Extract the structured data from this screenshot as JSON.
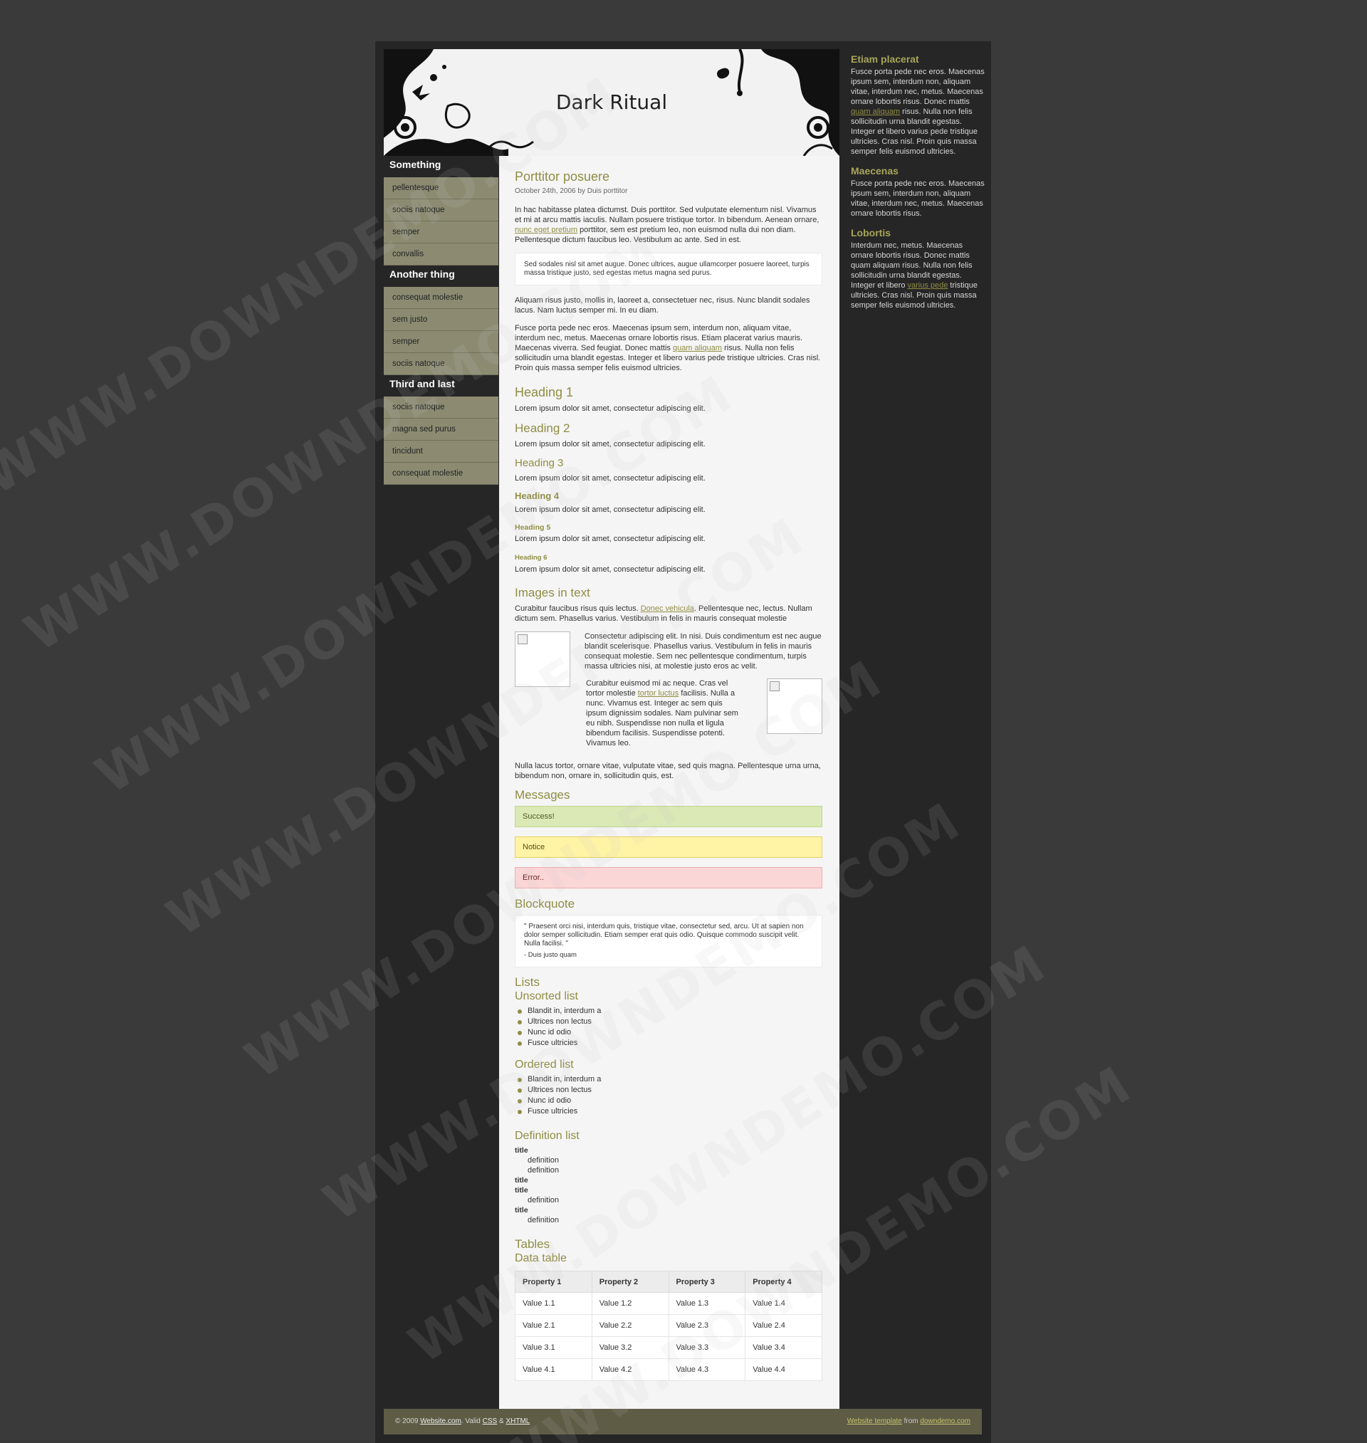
{
  "site_title": "Dark Ritual",
  "leftnav": [
    {
      "heading": "Something",
      "items": [
        "pellentesque",
        "sociis natoque",
        "semper",
        "convallis"
      ]
    },
    {
      "heading": "Another thing",
      "items": [
        "consequat molestie",
        "sem justo",
        "semper",
        "sociis natoque"
      ]
    },
    {
      "heading": "Third and last",
      "items": [
        "sociis natoque",
        "magna sed purus",
        "tincidunt",
        "consequat molestie"
      ]
    }
  ],
  "post": {
    "title": "Porttitor posuere",
    "meta": "October 24th, 2006 by Duis porttitor",
    "p1_a": "In hac habitasse platea dictumst. Duis porttitor. Sed vulputate elementum nisl. Vivamus et mi at arcu mattis iaculis. Nullam posuere tristique tortor. In bibendum. Aenean ornare, ",
    "p1_link": "nunc eget pretium",
    "p1_b": " porttitor, sem est pretium leo, non euismod nulla dui non diam. Pellentesque dictum faucibus leo. Vestibulum ac ante. Sed in est.",
    "quote": "Sed sodales nisl sit amet augue. Donec ultrices, augue ullamcorper posuere laoreet, turpis massa tristique justo, sed egestas metus magna sed purus.",
    "p2": "Aliquam risus justo, mollis in, laoreet a, consectetuer nec, risus. Nunc blandit sodales lacus. Nam luctus semper mi. In eu diam.",
    "p3_a": "Fusce porta pede nec eros. Maecenas ipsum sem, interdum non, aliquam vitae, interdum nec, metus. Maecenas ornare lobortis risus. Etiam placerat varius mauris. Maecenas viverra. Sed feugiat. Donec mattis ",
    "p3_link": "quam aliquam",
    "p3_b": " risus. Nulla non felis sollicitudin urna blandit egestas. Integer et libero varius pede tristique ultricies. Cras nisl. Proin quis massa semper felis euismod ultricies."
  },
  "headings": {
    "h1": "Heading 1",
    "h2": "Heading 2",
    "h3": "Heading 3",
    "h4": "Heading 4",
    "h5": "Heading 5",
    "h6": "Heading 6",
    "lorem": "Lorem ipsum dolor sit amet, consectetur adipiscing elit."
  },
  "images": {
    "title": "Images in text",
    "p1_a": "Curabitur faucibus risus quis lectus. ",
    "p1_link": "Donec vehicula",
    "p1_b": ". Pellentesque nec, lectus. Nullam dictum sem. Phasellus varius. Vestibulum in felis in mauris consequat molestie",
    "p2": "Consectetur adipiscing elit. In nisi. Duis condimentum est nec augue blandit scelerisque. Phasellus varius. Vestibulum in felis in mauris consequat molestie. Sem nec pellentesque condimentum, turpis massa ultricies nisi, at molestie justo eros ac velit.",
    "p3_a": "Curabitur euismod mi ac neque. Cras vel tortor molestie ",
    "p3_link": "tortor luctus",
    "p3_b": " facilisis. Nulla a nunc. Vivamus est. Integer ac sem quis ipsum dignissim sodales. Nam pulvinar sem eu nibh. Suspendisse non nulla et ligula bibendum facilisis. Suspendisse potenti. Vivamus leo.",
    "p4": "Nulla lacus tortor, ornare vitae, vulputate vitae, sed quis magna. Pellentesque urna urna, bibendum non, ornare in, sollicitudin quis, est."
  },
  "messages": {
    "title": "Messages",
    "success": "Success!",
    "notice": "Notice",
    "error": "Error.."
  },
  "blockquote": {
    "title": "Blockquote",
    "text": "\" Praesent orci nisi, interdum quis, tristique vitae, consectetur sed, arcu. Ut at sapien non dolor semper sollicitudin. Etiam semper erat quis odio. Quisque commodo suscipit velit. Nulla facilisi. \"",
    "cite": "- Duis justo quam"
  },
  "lists": {
    "title": "Lists",
    "unsorted_title": "Unsorted list",
    "unsorted": [
      "Blandit in, interdum a",
      "Ultrices non lectus",
      "Nunc id odio",
      "Fusce ultricies"
    ],
    "ordered_title": "Ordered list",
    "ordered": [
      "Blandit in, interdum a",
      "Ultrices non lectus",
      "Nunc id odio",
      "Fusce ultricies"
    ],
    "definition_title": "Definition list",
    "dt": "title",
    "dd": "definition"
  },
  "tables": {
    "title": "Tables",
    "subtitle": "Data table",
    "headers": [
      "Property 1",
      "Property 2",
      "Property 3",
      "Property 4"
    ],
    "rows": [
      [
        "Value 1.1",
        "Value 1.2",
        "Value 1.3",
        "Value 1.4"
      ],
      [
        "Value 2.1",
        "Value 2.2",
        "Value 2.3",
        "Value 2.4"
      ],
      [
        "Value 3.1",
        "Value 3.2",
        "Value 3.3",
        "Value 3.4"
      ],
      [
        "Value 4.1",
        "Value 4.2",
        "Value 4.3",
        "Value 4.4"
      ]
    ]
  },
  "sidebar": [
    {
      "title": "Etiam placerat",
      "text_a": "Fusce porta pede nec eros. Maecenas ipsum sem, interdum non, aliquam vitae, interdum nec, metus. Maecenas ornare lobortis risus. Donec mattis ",
      "link": "quam aliquam",
      "text_b": " risus. Nulla non felis sollicitudin urna blandit egestas. Integer et libero varius pede tristique ultricies. Cras nisl. Proin quis massa semper felis euismod ultricies."
    },
    {
      "title": "Maecenas",
      "text_a": "Fusce porta pede nec eros. Maecenas ipsum sem, interdum non, aliquam vitae, interdum nec, metus. Maecenas ornare lobortis risus.",
      "link": "",
      "text_b": ""
    },
    {
      "title": "Lobortis",
      "text_a": "Interdum nec, metus. Maecenas ornare lobortis risus. Donec mattis quam aliquam risus. Nulla non felis sollicitudin urna blandit egestas. Integer et libero ",
      "link": "varius pede",
      "text_b": " tristique ultricies. Cras nisl. Proin quis massa semper felis euismod ultricies."
    }
  ],
  "footer": {
    "copy": "© 2009 ",
    "site_link": "Website.com",
    "valid": ". Valid ",
    "css": "CSS",
    "amp": " & ",
    "xhtml": "XHTML",
    "tpl_link": "Website template",
    "from": " from ",
    "dd_link": "downdemo.com"
  },
  "watermark": "WWW.DOWNDEMO.COM",
  "colors": {
    "accent": "#8f8d44",
    "nav_bg": "#8c8b72",
    "page_bg": "#3a3a3a",
    "wrap_bg": "#262626",
    "content_bg": "#f5f5f5"
  }
}
